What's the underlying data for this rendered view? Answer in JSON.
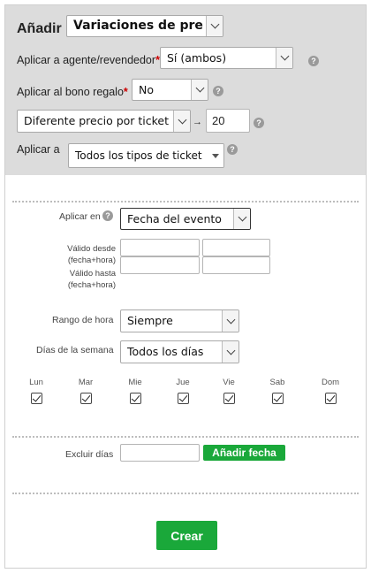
{
  "header": {
    "add_label": "Añadir",
    "type_select": "Variaciones de precio"
  },
  "apply_agent": {
    "label": "Aplicar a agente/revendedor",
    "required_mark": "*",
    "value": "Sí (ambos)"
  },
  "apply_gift": {
    "label": "Aplicar al bono regalo",
    "required_mark": "*",
    "value": "No"
  },
  "price_mode": {
    "value": "Diferente precio por ticket (E",
    "arrow": "→",
    "amount": "20"
  },
  "apply_to": {
    "label": "Aplicar a",
    "value": "Todos los tipos de ticket"
  },
  "apply_on": {
    "label": "Aplicar en",
    "value": "Fecha del evento"
  },
  "valid_from": {
    "label_line1": "Válido desde",
    "label_line2": "(fecha+hora)",
    "date": "",
    "time": ""
  },
  "valid_to": {
    "label_line1": "Válido hasta",
    "label_line2": "(fecha+hora)",
    "date": "",
    "time": ""
  },
  "hour_range": {
    "label": "Rango de hora",
    "value": "Siempre"
  },
  "weekdays": {
    "label": "Días de la semana",
    "value": "Todos los días",
    "days": [
      "Lun",
      "Mar",
      "Mie",
      "Jue",
      "Vie",
      "Sab",
      "Dom"
    ],
    "checked": [
      true,
      true,
      true,
      true,
      true,
      true,
      true
    ]
  },
  "exclude_days": {
    "label": "Excluir días",
    "value": "",
    "add_button": "Añadir fecha"
  },
  "create_button": "Crear",
  "help_glyph": "?",
  "colors": {
    "accent_green": "#1aa83a",
    "top_panel_bg": "#dcdcdc",
    "required_red": "#cc0000",
    "help_grey": "#9a9a9a"
  }
}
